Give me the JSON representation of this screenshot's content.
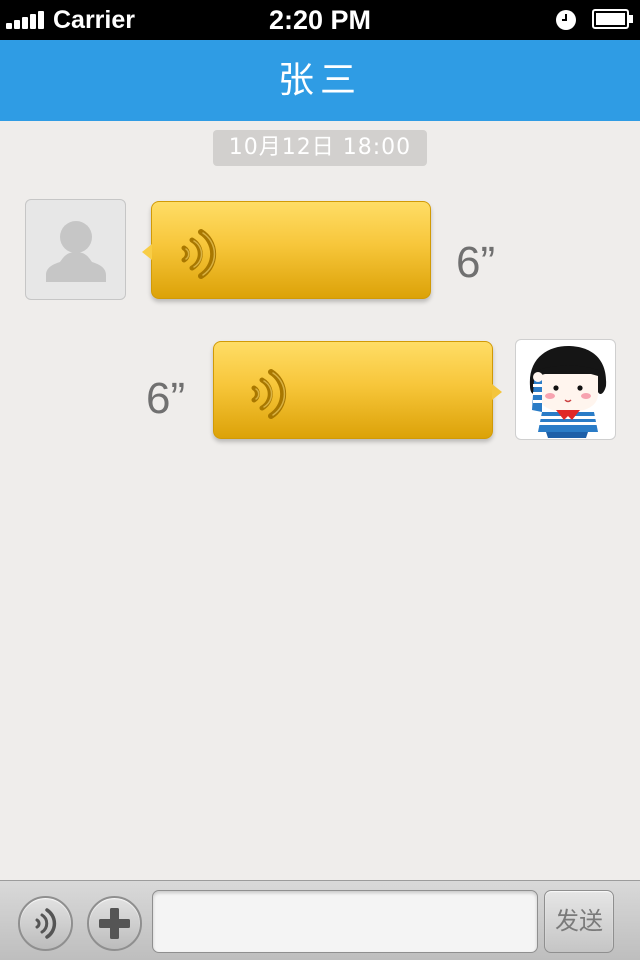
{
  "status_bar": {
    "carrier": "Carrier",
    "time": "2:20 PM",
    "signal_bars": 5,
    "icons": [
      "signal-icon",
      "alarm-icon",
      "battery-icon"
    ]
  },
  "header": {
    "title": "张三",
    "background_color": "#2f9ce4"
  },
  "chat": {
    "timestamp": "10月12日 18:00",
    "messages": [
      {
        "direction": "incoming",
        "type": "voice",
        "duration": "6”",
        "avatar": "default-avatar-icon"
      },
      {
        "direction": "outgoing",
        "type": "voice",
        "duration": "6”",
        "avatar": "cartoon-girl-avatar"
      }
    ],
    "bubble_color": "#f7c63a"
  },
  "toolbar": {
    "voice_button_icon": "voice-icon",
    "plus_button_icon": "plus-icon",
    "input_value": "",
    "input_placeholder": "",
    "send_label": "发送"
  }
}
